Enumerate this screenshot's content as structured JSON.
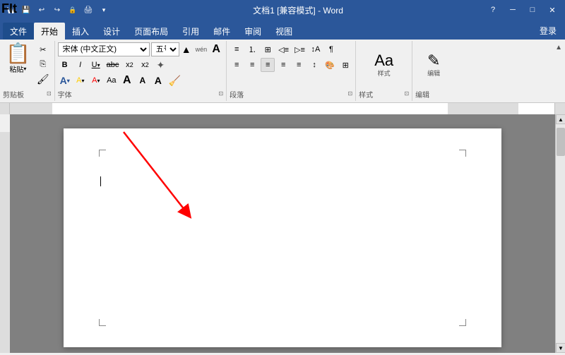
{
  "titlebar": {
    "title": "文档1 [兼容模式] - Word",
    "help_btn": "?",
    "minimize_btn": "─",
    "restore_btn": "□",
    "close_btn": "✕",
    "login_text": "登录"
  },
  "tabs": [
    {
      "label": "文件",
      "active": false
    },
    {
      "label": "开始",
      "active": true
    },
    {
      "label": "插入",
      "active": false
    },
    {
      "label": "设计",
      "active": false
    },
    {
      "label": "页面布局",
      "active": false
    },
    {
      "label": "引用",
      "active": false
    },
    {
      "label": "邮件",
      "active": false
    },
    {
      "label": "审阅",
      "active": false
    },
    {
      "label": "视图",
      "active": false
    }
  ],
  "groups": {
    "clipboard": {
      "label": "剪贴板",
      "paste": "粘贴"
    },
    "font": {
      "label": "字体",
      "font_name": "宋体 (中文正文)",
      "font_size": "五号",
      "bold": "B",
      "italic": "I",
      "underline": "U",
      "strikethrough": "abc",
      "subscript": "x₂",
      "superscript": "x²",
      "wubi": "wén",
      "aa_large": "A",
      "clear": "A",
      "highlight": "A",
      "font_color": "A",
      "font_aa": "Aa",
      "enlarge": "A",
      "shrink": "A",
      "font_expand": "A",
      "eraser": "A"
    },
    "paragraph": {
      "label": "段落"
    },
    "styles": {
      "label": "样式"
    },
    "editing": {
      "label": "编辑"
    }
  },
  "fit_label": "FIt",
  "scrollbar": {
    "up_arrow": "▲",
    "down_arrow": "▼"
  }
}
